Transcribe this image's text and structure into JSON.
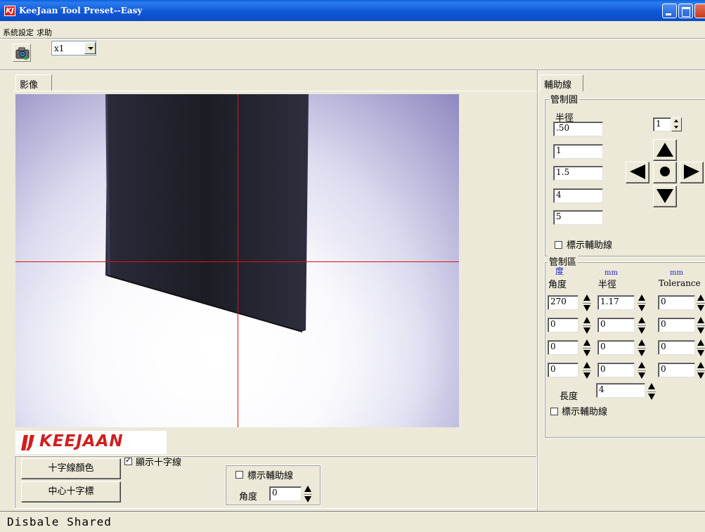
{
  "window": {
    "title": "KeeJaan Tool Preset--Easy",
    "app_icon_glyph": "KJ"
  },
  "menu": {
    "items": [
      "系統設定",
      "求助"
    ]
  },
  "toolbar": {
    "camera_icon": "camera-icon",
    "zoom_value": "x1"
  },
  "image_view": {
    "tab_label": "影像",
    "crosshair_color": "#e01010"
  },
  "logo": {
    "text": "KEEJAAN",
    "color": "#d21e1e"
  },
  "bottom_controls": {
    "crosshair_color_label": "十字線顏色",
    "center_crosshair_label": "中心十字標",
    "show_crosshair_label": "顯示十字線",
    "show_crosshair_checked": true,
    "show_guides_label": "標示輔助線",
    "show_guides_checked": false,
    "angle_label": "角度",
    "angle_value": "0"
  },
  "status": {
    "text": "Disbale Shared"
  },
  "right_panel": {
    "tab_label": "輔助線",
    "control_circle": {
      "group_label": "管制圓",
      "radius_label": "半徑",
      "radii": [
        ".50",
        "1",
        "1.5",
        "4",
        "5"
      ],
      "step_value": "1",
      "show_guides_label": "標示輔助線",
      "show_guides_checked": false
    },
    "control_zone": {
      "group_label": "管制區",
      "degree_unit": "度",
      "mm_unit": "mm",
      "angle_header": "角度",
      "radius_header": "半徑",
      "tolerance_header": "Tolerance",
      "rows": [
        {
          "angle": "270",
          "radius": "1.17",
          "tolerance": "0"
        },
        {
          "angle": "0",
          "radius": "0",
          "tolerance": "0"
        },
        {
          "angle": "0",
          "radius": "0",
          "tolerance": "0"
        },
        {
          "angle": "0",
          "radius": "0",
          "tolerance": "0"
        }
      ],
      "length_label": "長度",
      "length_value": "4",
      "show_guides_label": "標示輔助線",
      "show_guides_checked": false
    }
  }
}
